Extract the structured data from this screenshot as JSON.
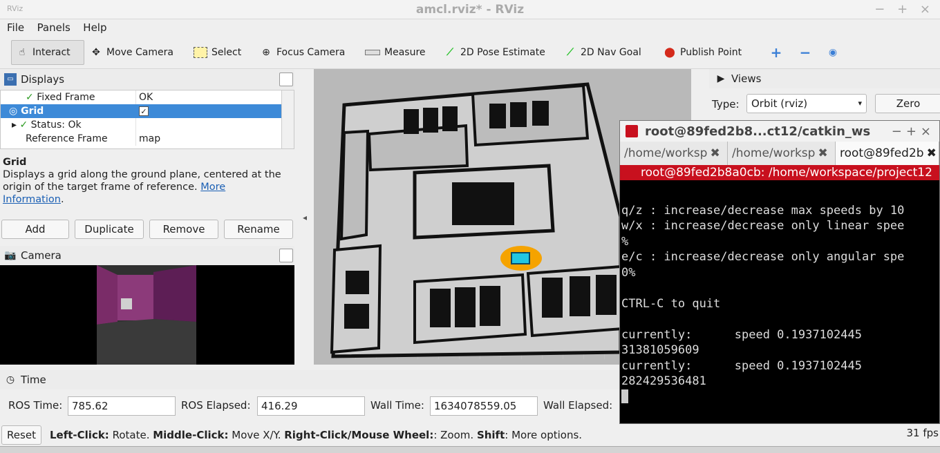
{
  "window": {
    "title": "amcl.rviz* - RViz",
    "controls": "− + ×",
    "logo": "RViz"
  },
  "menu": [
    "File",
    "Panels",
    "Help"
  ],
  "toolbar": {
    "interact": "Interact",
    "move_camera": "Move Camera",
    "select": "Select",
    "focus_camera": "Focus Camera",
    "measure": "Measure",
    "pose_estimate": "2D Pose Estimate",
    "nav_goal": "2D Nav Goal",
    "publish_point": "Publish Point"
  },
  "displays": {
    "title": "Displays",
    "rows": [
      {
        "name": "Fixed Frame",
        "value": "OK"
      },
      {
        "name": "Grid",
        "value": "✓"
      },
      {
        "name": "Status: Ok",
        "value": ""
      },
      {
        "name": "Reference Frame",
        "value": "map"
      }
    ],
    "desc_title": "Grid",
    "desc_text": "Displays a grid along the ground plane, centered at the origin of the target frame of reference.",
    "desc_link1": "More",
    "desc_link2": "Information",
    "buttons": {
      "add": "Add",
      "duplicate": "Duplicate",
      "remove": "Remove",
      "rename": "Rename"
    }
  },
  "camera": {
    "title": "Camera"
  },
  "views": {
    "title": "Views",
    "type_label": "Type:",
    "type_value": "Orbit (rviz)",
    "zero": "Zero"
  },
  "terminal": {
    "title": "root@89fed2b8...ct12/catkin_ws",
    "tabs": [
      "/home/worksp",
      "/home/worksp",
      "root@89fed2b"
    ],
    "path": "root@89fed2b8a0cb: /home/workspace/project12",
    "lines": [
      "",
      "q/z : increase/decrease max speeds by 10",
      "w/x : increase/decrease only linear spee",
      "%",
      "e/c : increase/decrease only angular spe",
      "0%",
      "",
      "CTRL-C to quit",
      "",
      "currently:      speed 0.1937102445",
      "31381059609",
      "currently:      speed 0.1937102445",
      "282429536481"
    ]
  },
  "time": {
    "title": "Time",
    "ros_time_label": "ROS Time:",
    "ros_time": "785.62",
    "ros_elapsed_label": "ROS Elapsed:",
    "ros_elapsed": "416.29",
    "wall_time_label": "Wall Time:",
    "wall_time": "1634078559.05",
    "wall_elapsed_label": "Wall Elapsed:"
  },
  "status": {
    "reset": "Reset",
    "left_click": "Left-Click:",
    "left_click_desc": " Rotate. ",
    "middle_click": "Middle-Click:",
    "middle_click_desc": " Move X/Y. ",
    "right_click": "Right-Click/Mouse Wheel:",
    "right_click_desc": ": Zoom. ",
    "shift": "Shift",
    "shift_desc": ": More options.",
    "fps": "31 fps"
  },
  "colors": {
    "selection": "#3d8ad8",
    "terminal_path": "#c8101e",
    "check": "#2a9a1f"
  }
}
